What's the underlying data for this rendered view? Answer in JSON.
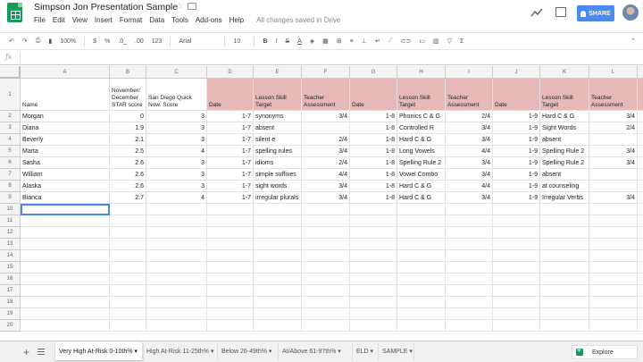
{
  "doc": {
    "title": "Simpson Jon Presentation Sample",
    "star_icon": "☆",
    "menu": [
      "File",
      "Edit",
      "View",
      "Insert",
      "Format",
      "Data",
      "Tools",
      "Add-ons",
      "Help"
    ],
    "saved_status": "All changes saved in Drive",
    "share_label": "SHARE"
  },
  "toolbar": {
    "zoom": "100%",
    "currency": "$",
    "percent": "%",
    "decimal_less": ".0_",
    "decimal_more": ".00",
    "format_more": "123",
    "font": "Arial",
    "font_size": "10",
    "bold": "B",
    "italic": "I",
    "strike": "S",
    "text_color": "A",
    "sigma": "Σ"
  },
  "formula": {
    "fx": "fx",
    "value": ""
  },
  "columns": [
    "A",
    "B",
    "C",
    "D",
    "E",
    "F",
    "G",
    "H",
    "I",
    "J",
    "K",
    "L"
  ],
  "header_row": {
    "A": "Name",
    "B": "November/ December STAR score",
    "C": "San Diego Quick Now. Score",
    "D": "Date",
    "E": "Lesson Skill Target",
    "F": "Teacher Assessment",
    "G": "Date",
    "H": "Lesson Skill Target",
    "I": "Teacher Assessment",
    "J": "Date",
    "K": "Lesson Skill Target",
    "L": "Teacher Assessment"
  },
  "rows": [
    {
      "n": "2",
      "name": "Morgan",
      "star": "0",
      "sd": "3",
      "d1": "1-7",
      "s1": "synonyms",
      "a1": "3/4",
      "d2": "1-8",
      "s2": "Phonics C & G",
      "a2": "2/4",
      "d3": "1-9",
      "s3": "Hard C & G",
      "a3": "3/4"
    },
    {
      "n": "3",
      "name": "Diana",
      "star": "1.9",
      "sd": "3",
      "d1": "1-7",
      "s1": "absent",
      "a1": "",
      "d2": "1-8",
      "s2": "Controlled R",
      "a2": "3/4",
      "d3": "1-9",
      "s3": "Sight Words",
      "a3": "2/4"
    },
    {
      "n": "4",
      "name": "Beverly",
      "star": "2.1",
      "sd": "3",
      "d1": "1-7",
      "s1": "silent e",
      "a1": "2/4",
      "d2": "1-8",
      "s2": "Hard C & G",
      "a2": "3/4",
      "d3": "1-9",
      "s3": "absent",
      "a3": ""
    },
    {
      "n": "5",
      "name": "Marta",
      "star": "2.5",
      "sd": "4",
      "d1": "1-7",
      "s1": "spelling rules",
      "a1": "3/4",
      "d2": "1-8",
      "s2": "Long Vowels",
      "a2": "4/4",
      "d3": "1-9",
      "s3": "Spelling Rule 2",
      "a3": "3/4"
    },
    {
      "n": "6",
      "name": "Sasha",
      "star": "2.6",
      "sd": "3",
      "d1": "1-7",
      "s1": "idioms",
      "a1": "2/4",
      "d2": "1-8",
      "s2": "Spelling Rule 2",
      "a2": "3/4",
      "d3": "1-9",
      "s3": "Spelling Rule 2",
      "a3": "3/4"
    },
    {
      "n": "7",
      "name": "William",
      "star": "2.6",
      "sd": "3",
      "d1": "1-7",
      "s1": "simple suffixes",
      "a1": "4/4",
      "d2": "1-8",
      "s2": "Vowel Combo",
      "a2": "3/4",
      "d3": "1-9",
      "s3": "absent",
      "a3": ""
    },
    {
      "n": "8",
      "name": "Alaska",
      "star": "2.6",
      "sd": "3",
      "d1": "1-7",
      "s1": "sight words",
      "a1": "3/4",
      "d2": "1-8",
      "s2": "Hard C & G",
      "a2": "4/4",
      "d3": "1-9",
      "s3": "at counseling",
      "a3": ""
    },
    {
      "n": "9",
      "name": "Bianca",
      "star": "2.7",
      "sd": "4",
      "d1": "1-7",
      "s1": "irregular plurals",
      "a1": "3/4",
      "d2": "1-8",
      "s2": "Hard C & G",
      "a2": "3/4",
      "d3": "1-9",
      "s3": "Irregular Verbs",
      "a3": "3/4"
    }
  ],
  "empty_rows": [
    "10",
    "11",
    "12",
    "13",
    "14",
    "15",
    "16",
    "17",
    "18",
    "19",
    "20"
  ],
  "sheet_tabs": [
    {
      "label": "Very High At-Risk 0-10th% ▾",
      "active": true
    },
    {
      "label": "High At-Risk 11-25th% ▾",
      "active": false
    },
    {
      "label": "Below 26-49th% ▾",
      "active": false
    },
    {
      "label": "At/Above 61-97th% ▾",
      "active": false
    },
    {
      "label": "ELD ▾",
      "active": false
    },
    {
      "label": "SAMPLE ▾",
      "active": false
    }
  ],
  "explore_label": "Explore",
  "colors": {
    "header_pink": "#e6b8b7",
    "share_blue": "#4a8af4",
    "sheets_green": "#0f9d58",
    "selection_blue": "#4a86e8"
  }
}
